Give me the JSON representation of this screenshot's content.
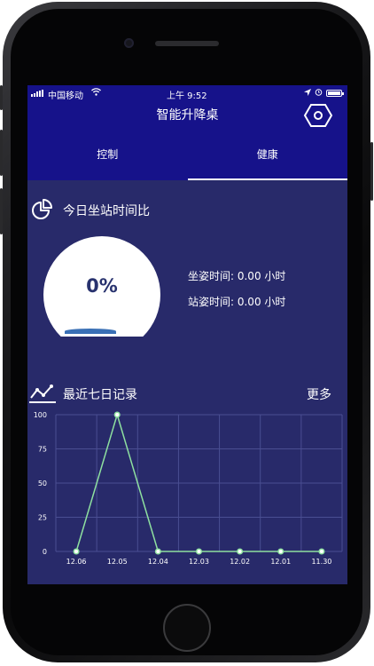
{
  "status_bar": {
    "carrier": "中国移动",
    "time": "上午 9:52"
  },
  "header": {
    "title": "智能升降桌",
    "icons": [
      "hexagon-settings-icon"
    ]
  },
  "tabs": [
    {
      "label": "控制",
      "active": false
    },
    {
      "label": "健康",
      "active": true
    }
  ],
  "today": {
    "title": "今日坐站时间比",
    "percent": "0%",
    "sit_time": "坐姿时间: 0.00 小时",
    "stand_time": "站姿时间: 0.00 小时"
  },
  "weekly": {
    "title": "最近七日记录",
    "more_label": "更多"
  },
  "colors": {
    "screen_bg": "#282a6a",
    "header_bg": "#16128a",
    "line": "#8ee0a0"
  },
  "chart_data": {
    "type": "line",
    "categories": [
      "12.06",
      "12.05",
      "12.04",
      "12.03",
      "12.02",
      "12.01",
      "11.30"
    ],
    "series": [
      {
        "values": [
          0,
          100,
          0,
          0,
          0,
          0,
          0
        ]
      }
    ],
    "ylim": [
      0,
      100
    ],
    "yticks": [
      0,
      25,
      50,
      75,
      100
    ],
    "grid": true
  }
}
